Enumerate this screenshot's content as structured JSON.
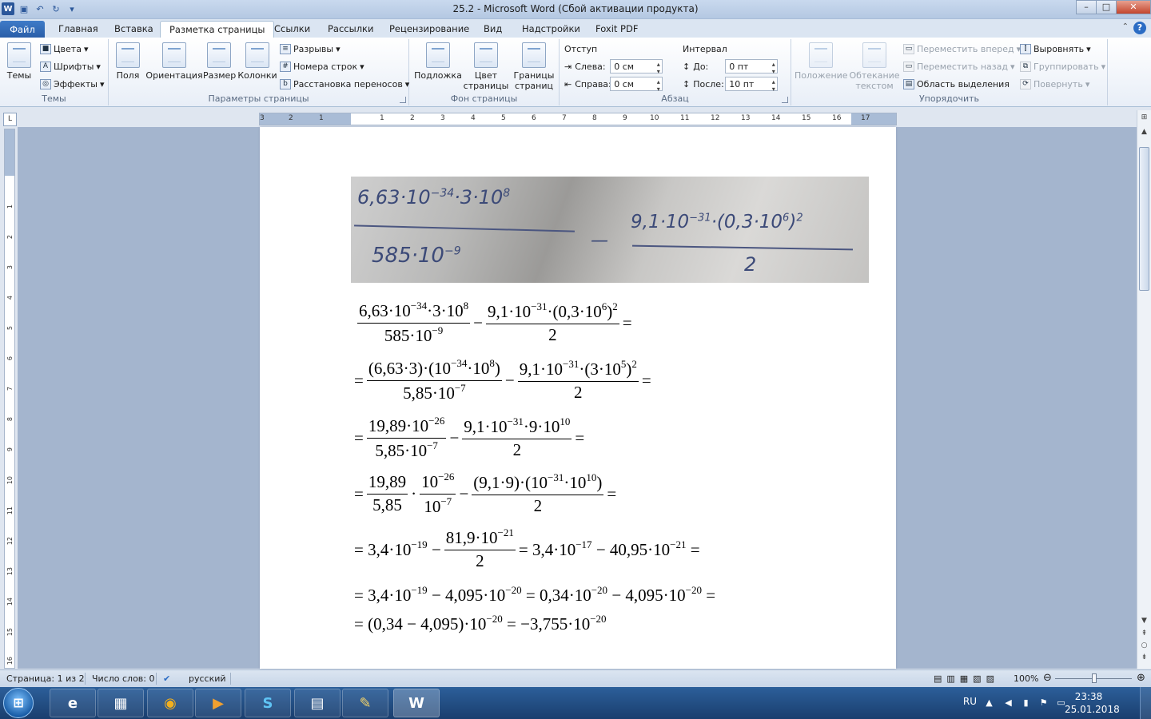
{
  "window": {
    "title": "25.2  -  Microsoft Word (Сбой активации продукта)",
    "controls": {
      "minimize": "–",
      "maximize": "□",
      "close": "✕"
    }
  },
  "tabs": [
    {
      "label": "Файл"
    },
    {
      "label": "Главная"
    },
    {
      "label": "Вставка"
    },
    {
      "label": "Разметка страницы"
    },
    {
      "label": "Ссылки"
    },
    {
      "label": "Рассылки"
    },
    {
      "label": "Рецензирование"
    },
    {
      "label": "Вид"
    },
    {
      "label": "Надстройки"
    },
    {
      "label": "Foxit PDF"
    }
  ],
  "ribbon": {
    "themes": {
      "themes_label": "Темы",
      "colors": "Цвета",
      "fonts": "Шрифты",
      "effects": "Эффекты",
      "group": "Темы"
    },
    "page_setup": {
      "margins": "Поля",
      "orientation": "Ориентация",
      "size": "Размер",
      "columns": "Колонки",
      "breaks": "Разрывы",
      "line_numbers": "Номера строк",
      "hyphenation": "Расстановка переносов",
      "group": "Параметры страницы"
    },
    "page_background": {
      "watermark": "Подложка",
      "page_color": "Цвет страницы",
      "page_borders": "Границы страниц",
      "group": "Фон страницы"
    },
    "paragraph": {
      "indent_title": "Отступ",
      "left_label": "Слева:",
      "left_value": "0 см",
      "right_label": "Справа:",
      "right_value": "0 см",
      "spacing_title": "Интервал",
      "before_label": "До:",
      "before_value": "0 пт",
      "after_label": "После:",
      "after_value": "10 пт",
      "group": "Абзац"
    },
    "arrange": {
      "position": "Положение",
      "wrap_text": "Обтекание текстом",
      "bring_forward": "Переместить вперед",
      "send_backward": "Переместить назад",
      "selection_pane": "Область выделения",
      "align": "Выровнять",
      "group_obj": "Группировать",
      "rotate": "Повернуть",
      "group": "Упорядочить"
    }
  },
  "ruler": {
    "horizontal_ticks": [
      "3",
      "2",
      "1",
      "1",
      "2",
      "3",
      "4",
      "5",
      "6",
      "7",
      "8",
      "9",
      "10",
      "11",
      "12",
      "13",
      "14",
      "15",
      "16",
      "17"
    ],
    "vertical_ticks": [
      "1",
      "2",
      "3",
      "4",
      "5",
      "6",
      "7",
      "8",
      "9",
      "10",
      "11",
      "12",
      "13",
      "14",
      "15",
      "16"
    ]
  },
  "document": {
    "photo_text": {
      "num1": "6,63·10",
      "num1_exp": "−34",
      "num1_rest": "·3·10",
      "num1_exp2": "8",
      "den1": "585·10",
      "den1_exp": "−9",
      "minus": "—",
      "num2": "9,1·10",
      "num2_exp": "−31",
      "num2_rest": "·(0,3·10",
      "num2_exp2": "6",
      "num2_close": ")",
      "num2_pow": "2",
      "den2": "2"
    },
    "equations": [
      {
        "id": "l1"
      },
      {
        "id": "l2"
      }
    ]
  },
  "statusbar": {
    "page": "Страница: 1 из 2",
    "words": "Число слов: 0",
    "language": "русский",
    "zoom": "100%"
  },
  "taskbar": {
    "apps": [
      "explorer-icon",
      "ie-icon",
      "folder-icon",
      "chrome-icon",
      "media-icon",
      "skype-icon",
      "calculator-icon",
      "paint-icon",
      "word-icon"
    ],
    "tray_lang": "RU",
    "time": "23:38",
    "date": "25.01.2018"
  }
}
